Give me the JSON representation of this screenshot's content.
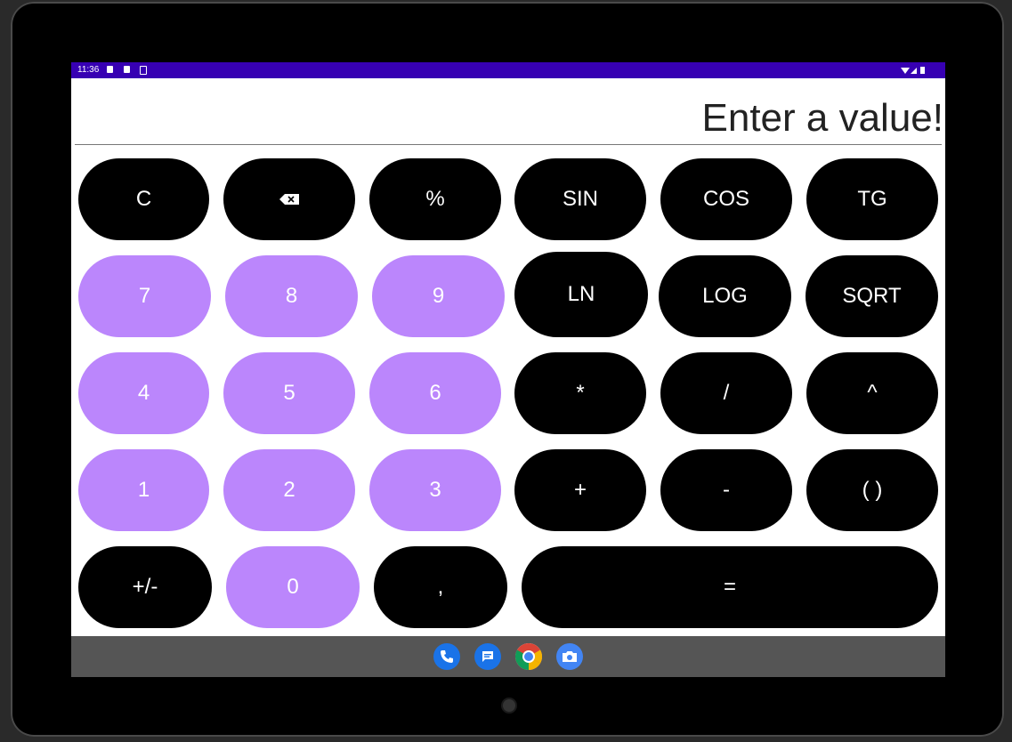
{
  "status_bar": {
    "time": "11:36"
  },
  "display": {
    "value": "Enter a value!"
  },
  "buttons": {
    "clear": "C",
    "percent": "%",
    "sin": "SIN",
    "cos": "COS",
    "tg": "TG",
    "n7": "7",
    "n8": "8",
    "n9": "9",
    "ln": "LN",
    "log": "LOG",
    "sqrt": "SQRT",
    "n4": "4",
    "n5": "5",
    "n6": "6",
    "multiply": "*",
    "divide": "/",
    "power": "^",
    "n1": "1",
    "n2": "2",
    "n3": "3",
    "plus": "+",
    "minus": "-",
    "parens": "( )",
    "sign": "+/-",
    "n0": "0",
    "comma": ",",
    "equals": "="
  },
  "colors": {
    "status_bar": "#3700b3",
    "digit_button": "#bb86fc",
    "op_button": "#000000",
    "nav_bar": "#555555"
  },
  "dock_icons": [
    "phone-icon",
    "messages-icon",
    "chrome-icon",
    "camera-icon"
  ]
}
